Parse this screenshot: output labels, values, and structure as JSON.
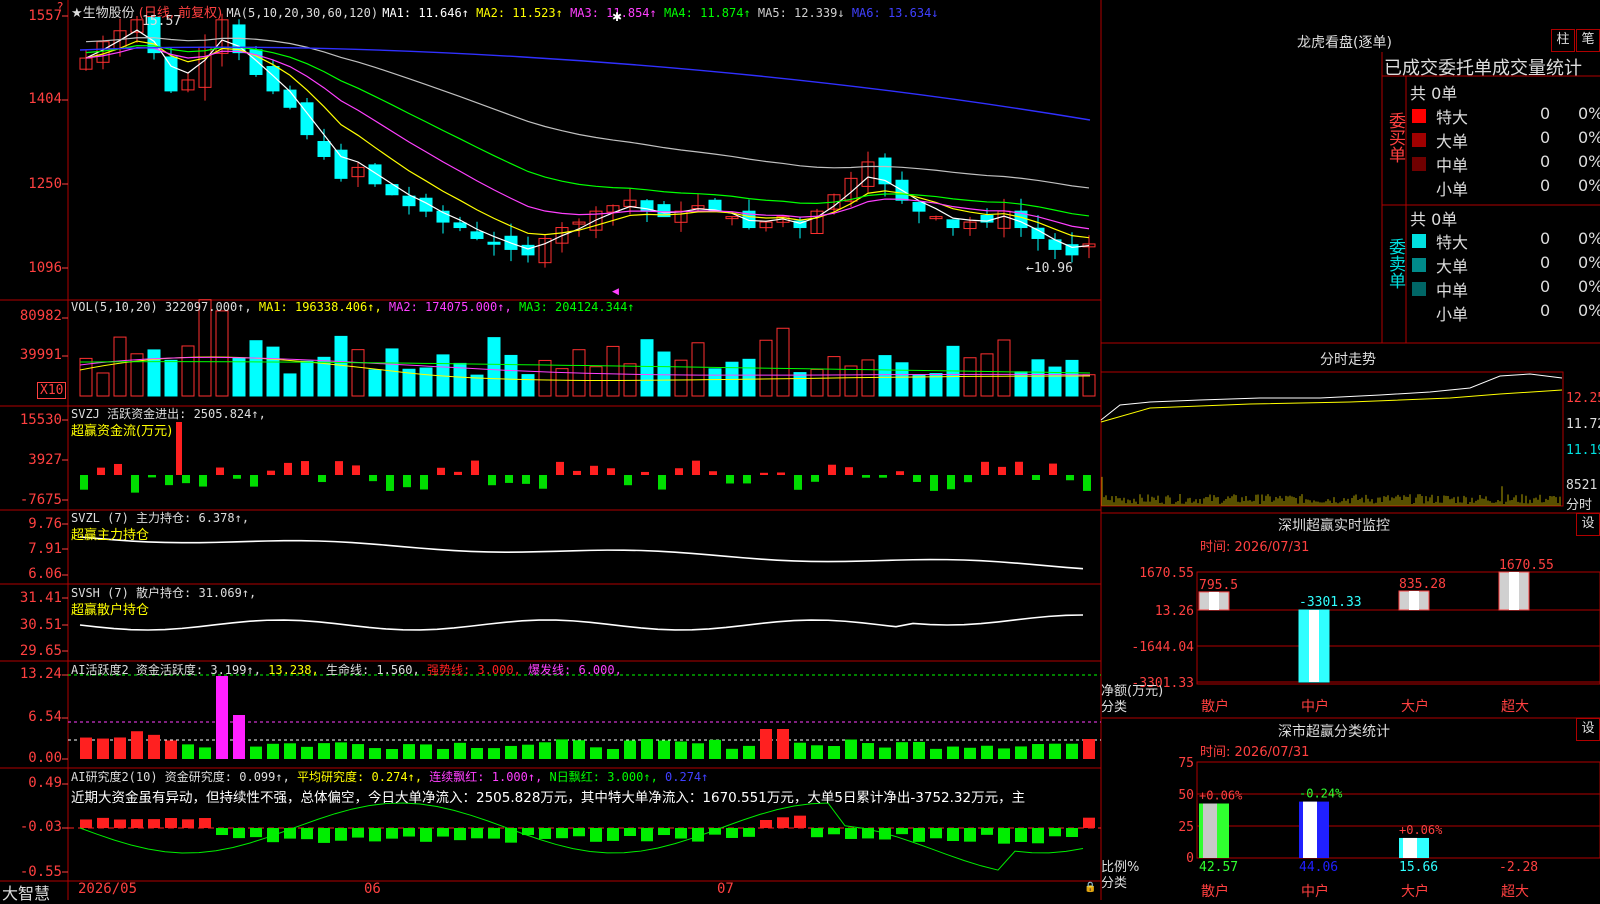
{
  "app": {
    "brand": "大智慧"
  },
  "main": {
    "stock_title": "★生物股份",
    "title_tag": "(日线, 前复权)",
    "ma_legend": {
      "label": "MA(5,10,20,30,60,120)",
      "items": [
        {
          "text": "MA1: 11.646↑",
          "color": "#ffffff"
        },
        {
          "text": "MA2: 11.523↑",
          "color": "#ffff00"
        },
        {
          "text": "MA3: 11.854↑",
          "color": "#ff40ff"
        },
        {
          "text": "MA4: 11.874↑",
          "color": "#00ff00"
        },
        {
          "text": "MA5: 12.339↓",
          "color": "#d0d0d0"
        },
        {
          "text": "MA6: 13.634↓",
          "color": "#4040ff"
        }
      ]
    },
    "high_label": "15.57",
    "low_label": "←10.96",
    "y_ticks": [
      "1557",
      "1404",
      "1250",
      "1096"
    ]
  },
  "vol": {
    "legend": [
      {
        "text": "VOL(5,10,20)  322097.000↑,",
        "color": "#dddddd"
      },
      {
        "text": "MA1: 196338.406↑,",
        "color": "#ffff00"
      },
      {
        "text": "MA2: 174075.000↑,",
        "color": "#ff40ff"
      },
      {
        "text": "MA3: 204124.344↑",
        "color": "#00ff00"
      }
    ],
    "y_ticks": [
      "80982",
      "39991"
    ],
    "unit_badge": "X10"
  },
  "svzj": {
    "legend": "SVZJ  活跃资金进出: 2505.824↑,",
    "sub": "超赢资金流(万元)",
    "y_ticks": [
      "15530",
      "3927",
      "-7675"
    ]
  },
  "svzl": {
    "legend": "SVZL (7) 主力持仓: 6.378↑,",
    "sub": "超赢主力持仓",
    "y_ticks": [
      "9.76",
      "7.91",
      "6.06"
    ]
  },
  "svsh": {
    "legend": "SVSH (7) 散户持仓: 31.069↑,",
    "sub": "超赢散户持仓",
    "y_ticks": [
      "31.41",
      "30.51",
      "29.65"
    ]
  },
  "ai1": {
    "legend": [
      {
        "text": "AI活跃度2 资金活跃度: 3.199↑,",
        "color": "#dddddd"
      },
      {
        "text": "13.238,",
        "color": "#ffff00"
      },
      {
        "text": "生命线: 1.560,",
        "color": "#dddddd"
      },
      {
        "text": "强势线: 3.000,",
        "color": "#ff2020"
      },
      {
        "text": "爆发线: 6.000,",
        "color": "#ff40ff"
      }
    ],
    "y_ticks": [
      "13.24",
      "6.54",
      "0.00"
    ]
  },
  "ai2": {
    "legend": [
      {
        "text": "AI研究度2(10) 资金研究度: 0.099↑,",
        "color": "#dddddd"
      },
      {
        "text": "平均研究度: 0.274↑,",
        "color": "#ffff00"
      },
      {
        "text": "连续飘红: 1.000↑,",
        "color": "#ff40ff"
      },
      {
        "text": "N日飘红: 3.000↑,",
        "color": "#00ff00"
      },
      {
        "text": "0.274↑",
        "color": "#4040ff"
      }
    ],
    "comment": "近期大资金虽有异动，但持续性不强，总体偏空，今日大单净流入：2505.828万元，其中特大单净流入：1670.551万元，大单5日累计净出-3752.32万元，主",
    "y_ticks": [
      "0.49",
      "-0.03",
      "-0.55"
    ]
  },
  "xaxis": {
    "labels": [
      "2026/05",
      "06",
      "07"
    ]
  },
  "right": {
    "lhb_title": "龙虎看盘(逐单)",
    "btn_bar": "柱",
    "btn_pen": "笔",
    "header": "已成交委托单成交量统计",
    "buy": {
      "side": "委买单",
      "total": "共 0单",
      "rows": [
        {
          "label": "特大",
          "value": "0",
          "pct": "0%",
          "color": "#ff0000"
        },
        {
          "label": "大单",
          "value": "0",
          "pct": "0%",
          "color": "#a00000"
        },
        {
          "label": "中单",
          "value": "0",
          "pct": "0%",
          "color": "#700000"
        },
        {
          "label": "小单",
          "value": "0",
          "pct": "0%",
          "color": ""
        }
      ]
    },
    "sell": {
      "side": "委卖单",
      "total": "共 0单",
      "rows": [
        {
          "label": "特大",
          "value": "0",
          "pct": "0%",
          "color": "#00e0e0"
        },
        {
          "label": "大单",
          "value": "0",
          "pct": "0%",
          "color": "#008a8a"
        },
        {
          "label": "中单",
          "value": "0",
          "pct": "0%",
          "color": "#006666"
        },
        {
          "label": "小单",
          "value": "0",
          "pct": "0%",
          "color": ""
        }
      ]
    },
    "intraday": {
      "title": "分时走势",
      "y_ticks": [
        "12.25",
        "11.72",
        "11.19"
      ],
      "vol_label": "8521",
      "vol_unit": "分时"
    },
    "monitor": {
      "title": "深圳超赢实时监控",
      "set": "设",
      "time": "时间: 2026/07/31",
      "y_ticks": [
        "1670.55",
        "13.26",
        "-1644.04",
        "-3301.33"
      ],
      "y_title": "净额(万元)",
      "x_title": "分类",
      "categories": [
        "散户",
        "中户",
        "大户",
        "超大"
      ],
      "values": [
        795.5,
        -3301.33,
        835.28,
        1670.55
      ],
      "value_labels": [
        "795.5",
        "-3301.33",
        "835.28",
        "1670.55"
      ]
    },
    "stats": {
      "title": "深市超赢分类统计",
      "set": "设",
      "time": "时间: 2026/07/31",
      "y_ticks": [
        "75",
        "50",
        "25",
        "0"
      ],
      "y_title": "比例%",
      "x_title": "分类",
      "categories": [
        "散户",
        "中户",
        "大户",
        "超大"
      ],
      "values": [
        42.57,
        44.06,
        15.66,
        -2.28
      ],
      "top_labels": [
        "+0.06%",
        "-0.24%",
        "+0.06%",
        ""
      ],
      "bottom_labels": [
        "42.57",
        "44.06",
        "15.66",
        "-2.28"
      ]
    }
  },
  "chart_data": {
    "type": "bar",
    "categories": [
      "散户",
      "中户",
      "大户",
      "超大"
    ],
    "series": [
      {
        "name": "净额(万元)",
        "values": [
          795.5,
          -3301.33,
          835.28,
          1670.55
        ]
      },
      {
        "name": "比例%",
        "values": [
          42.57,
          44.06,
          15.66,
          -2.28
        ]
      }
    ],
    "title": "深圳超赢实时监控"
  }
}
